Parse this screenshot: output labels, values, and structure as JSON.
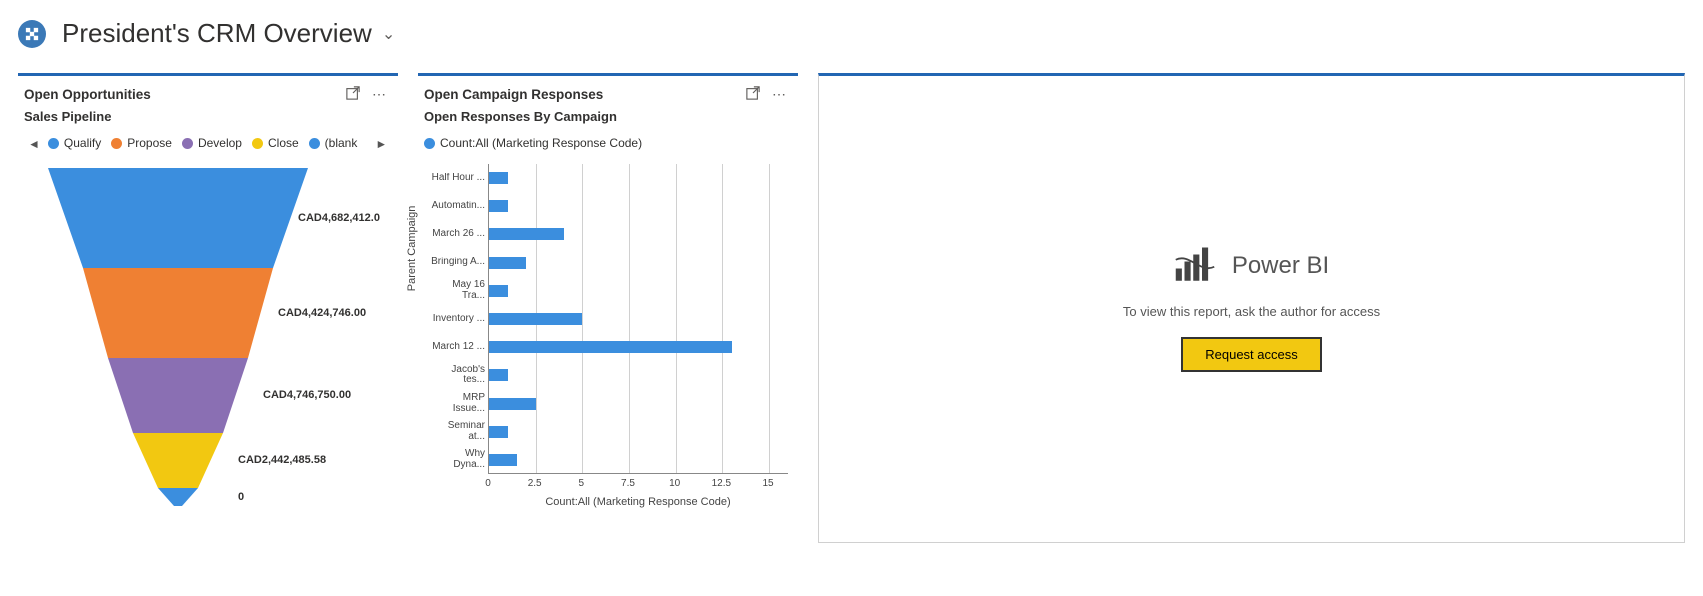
{
  "header": {
    "title": "President's CRM Overview"
  },
  "panel1": {
    "title": "Open Opportunities",
    "subtitle": "Sales Pipeline",
    "legend": [
      {
        "label": "Qualify",
        "color": "#3b8ede"
      },
      {
        "label": "Propose",
        "color": "#ef8033"
      },
      {
        "label": "Develop",
        "color": "#8a6fb3"
      },
      {
        "label": "Close",
        "color": "#f2c811"
      },
      {
        "label": "(blank",
        "color": "#3b8ede"
      }
    ],
    "funnel": [
      {
        "label": "CAD4,682,412.0",
        "color": "#3b8ede"
      },
      {
        "label": "CAD4,424,746.00",
        "color": "#ef8033"
      },
      {
        "label": "CAD4,746,750.00",
        "color": "#8a6fb3"
      },
      {
        "label": "CAD2,442,485.58",
        "color": "#f2c811"
      },
      {
        "label": "0",
        "color": "#3b8ede"
      }
    ]
  },
  "panel2": {
    "title": "Open Campaign Responses",
    "subtitle": "Open Responses By Campaign",
    "legendLabel": "Count:All (Marketing Response Code)",
    "legendColor": "#3b8ede",
    "xlabel": "Count:All (Marketing Response Code)",
    "ylabel": "Parent Campaign",
    "xticks": [
      "0",
      "2.5",
      "5",
      "7.5",
      "10",
      "12.5",
      "15"
    ]
  },
  "panel3": {
    "brand": "Power BI",
    "message": "To view this report, ask the author for access",
    "button": "Request access"
  },
  "chart_data": [
    {
      "type": "bar",
      "title": "Sales Pipeline",
      "series": [
        {
          "name": "Qualify",
          "value": 4682412.0
        },
        {
          "name": "Propose",
          "value": 4424746.0
        },
        {
          "name": "Develop",
          "value": 4746750.0
        },
        {
          "name": "Close",
          "value": 2442485.58
        },
        {
          "name": "(blank)",
          "value": 0
        }
      ],
      "currency": "CAD"
    },
    {
      "type": "bar",
      "orientation": "horizontal",
      "title": "Open Responses By Campaign",
      "xlabel": "Count:All (Marketing Response Code)",
      "ylabel": "Parent Campaign",
      "xlim": [
        0,
        15
      ],
      "categories": [
        "Half Hour ...",
        "Automatin...",
        "March 26 ...",
        "Bringing A...",
        "May 16 Tra...",
        "Inventory ...",
        "March 12 ...",
        "Jacob's tes...",
        "MRP Issue...",
        "Seminar at...",
        "Why Dyna..."
      ],
      "values": [
        1,
        1,
        4,
        2,
        1,
        5,
        13,
        1,
        2.5,
        1,
        1.5
      ]
    }
  ]
}
